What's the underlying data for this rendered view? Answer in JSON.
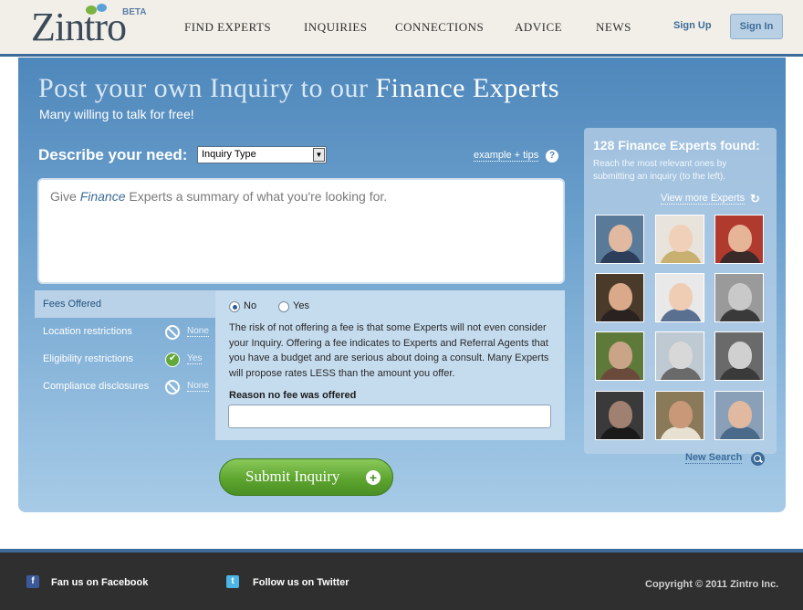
{
  "brand": {
    "name": "Zintro",
    "badge": "BETA"
  },
  "nav": {
    "find_experts": "FIND EXPERTS",
    "inquiries": "INQUIRIES",
    "connections": "CONNECTIONS",
    "advice": "ADVICE",
    "news": "NEWS",
    "sign_up": "Sign Up",
    "sign_in": "Sign In"
  },
  "hero": {
    "title_prefix": "Post your own Inquiry to our",
    "title_emphasis": "Finance Experts",
    "subtitle": "Many willing to talk for free!"
  },
  "form": {
    "describe_label": "Describe your need:",
    "inquiry_type_selected": "Inquiry Type",
    "tips_link": "example + tips",
    "summary_placeholder_before": "Give",
    "summary_placeholder_em": "Finance",
    "summary_placeholder_after": "Experts a summary of what you're looking for.",
    "submit_label": "Submit Inquiry"
  },
  "sidebar": {
    "items": [
      {
        "label": "Fees Offered",
        "value": ""
      },
      {
        "label": "Location restrictions",
        "value": "None",
        "status": "none"
      },
      {
        "label": "Eligibility restrictions",
        "value": "Yes",
        "status": "yes"
      },
      {
        "label": "Compliance disclosures",
        "value": "None",
        "status": "none"
      }
    ]
  },
  "fees": {
    "option_no": "No",
    "option_yes": "Yes",
    "selected": "No",
    "explanation": "The risk of not offering a fee is that some Experts will not even consider your Inquiry. Offering a fee indicates to Experts and Referral Agents that you have a budget and are serious about doing a consult. Many Experts will propose rates LESS than the amount you offer.",
    "reason_label": "Reason no fee was offered",
    "reason_value": ""
  },
  "experts": {
    "title": "128 Finance Experts found:",
    "subtitle": "Reach the most relevant ones by submitting an inquiry (to the left).",
    "view_more": "View more Experts",
    "new_search": "New Search",
    "avatars": [
      {
        "skin": "#e0b9a0",
        "bg": "#5a7a9a",
        "shirt": "#2c3e5a"
      },
      {
        "skin": "#f0d0b8",
        "bg": "#e8e4dc",
        "shirt": "#c8b070"
      },
      {
        "skin": "#e6b497",
        "bg": "#b03a2e",
        "shirt": "#3a2a2a"
      },
      {
        "skin": "#d9a98a",
        "bg": "#4a3a2a",
        "shirt": "#2a2220"
      },
      {
        "skin": "#efcdb4",
        "bg": "#e9e9e9",
        "shirt": "#5a7090"
      },
      {
        "skin": "#c9c9c9",
        "bg": "#9a9a9a",
        "shirt": "#3a3a3a"
      },
      {
        "skin": "#c9a487",
        "bg": "#5e7a3a",
        "shirt": "#6a4a3a"
      },
      {
        "skin": "#d8d8d8",
        "bg": "#bfc9d2",
        "shirt": "#6a6a6a"
      },
      {
        "skin": "#d0d0d0",
        "bg": "#6a6a6a",
        "shirt": "#3a3a3a"
      },
      {
        "skin": "#a08070",
        "bg": "#3a3a3a",
        "shirt": "#1a1a1a"
      },
      {
        "skin": "#c89878",
        "bg": "#8a7a5a",
        "shirt": "#e8e0d0"
      },
      {
        "skin": "#e0b9a0",
        "bg": "#8aa0b8",
        "shirt": "#4a6a8a"
      }
    ]
  },
  "footer": {
    "facebook": "Fan us on Facebook",
    "twitter": "Follow us on Twitter",
    "copyright": "Copyright © 2011 Zintro Inc."
  }
}
